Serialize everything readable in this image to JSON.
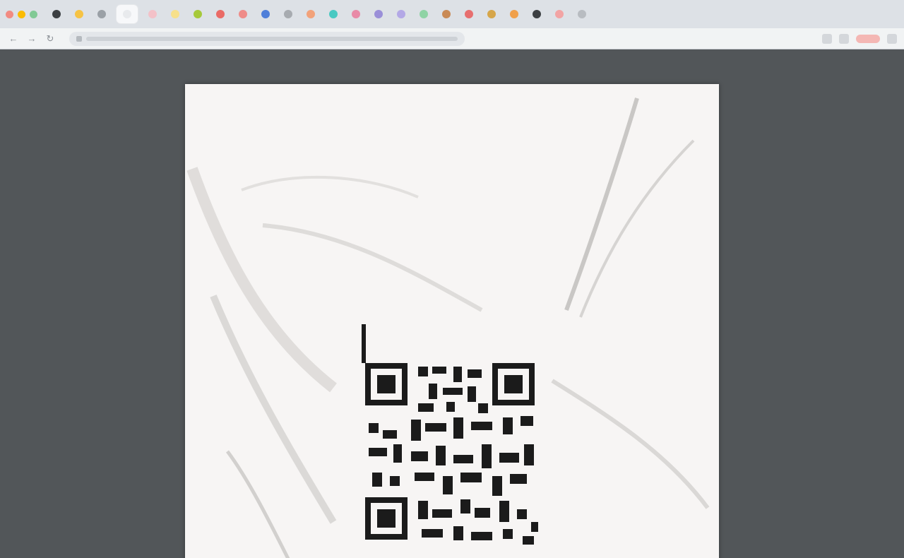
{
  "browser": {
    "window_controls": [
      {
        "name": "close",
        "color": "#f28b82"
      },
      {
        "name": "minimize",
        "color": "#fbbc04"
      },
      {
        "name": "maximize",
        "color": "#81c995"
      }
    ],
    "tabs": [
      {
        "favicon": "dark-icon",
        "color": "#3c4043"
      },
      {
        "favicon": "yellow-icon",
        "color": "#f6c344"
      },
      {
        "favicon": "gray-icon",
        "color": "#9aa0a6"
      },
      {
        "favicon": "pale-icon",
        "color": "#e8eaed"
      },
      {
        "favicon": "pink-icon",
        "color": "#f3c1c8"
      },
      {
        "favicon": "yellow-icon",
        "color": "#f7e08a"
      },
      {
        "favicon": "lime-icon",
        "color": "#a6c93a"
      },
      {
        "favicon": "red-icon",
        "color": "#ea6b66"
      },
      {
        "favicon": "red-icon",
        "color": "#ef8c89"
      },
      {
        "favicon": "blue-icon",
        "color": "#4f7fd9"
      },
      {
        "favicon": "gray-icon",
        "color": "#a7abb0"
      },
      {
        "favicon": "orange-icon",
        "color": "#f2a27a"
      },
      {
        "favicon": "teal-icon",
        "color": "#48c9c2"
      },
      {
        "favicon": "pink-icon",
        "color": "#e88aa7"
      },
      {
        "favicon": "purple-icon",
        "color": "#9a8fd8"
      },
      {
        "favicon": "lavender-icon",
        "color": "#b3a8e6"
      },
      {
        "favicon": "green-icon",
        "color": "#8fd3a5"
      },
      {
        "favicon": "brown-icon",
        "color": "#c98a55"
      },
      {
        "favicon": "red-icon",
        "color": "#e76f6f"
      },
      {
        "favicon": "gold-icon",
        "color": "#d6a64a"
      },
      {
        "favicon": "orange-icon",
        "color": "#f0a04b"
      },
      {
        "favicon": "dark-icon",
        "color": "#3c4043"
      },
      {
        "favicon": "pink-icon",
        "color": "#f2a4a4"
      },
      {
        "favicon": "gray-icon",
        "color": "#b8bcc1"
      }
    ],
    "active_tab_index": 3,
    "colors": {
      "tabstrip": "#dde1e6",
      "toolbar": "#f1f3f4",
      "viewer_bg": "#525659",
      "page_bg": "#f7f5f4"
    }
  },
  "page": {
    "heading": "",
    "labels": [
      "",
      "",
      "",
      ""
    ]
  }
}
